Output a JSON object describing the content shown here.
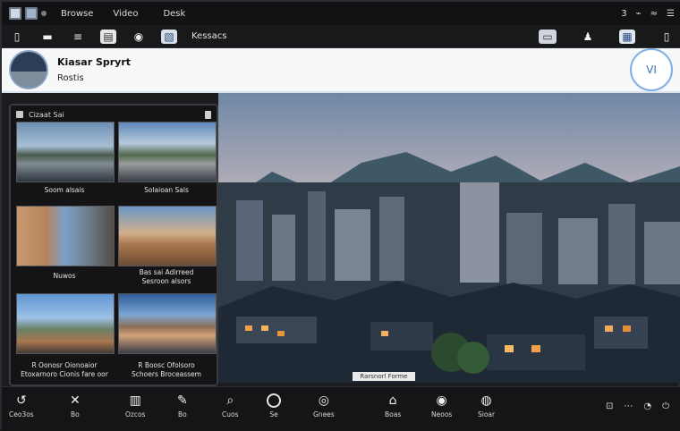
{
  "menubar": {
    "items": [
      "Browse",
      "Video",
      "Desk"
    ],
    "right": [
      "3",
      "⌁",
      "≈",
      "☰"
    ]
  },
  "toolbar": {
    "label": "Kessacs"
  },
  "header": {
    "title": "Kiasar Spryrt",
    "subtitle": "Rostis",
    "badge": "VI"
  },
  "panel": {
    "title": "Cizaat Sai",
    "thumbs": [
      {
        "caption": "Soom alsais"
      },
      {
        "caption": "Solaioan Sals"
      },
      {
        "caption": "Nuwos"
      },
      {
        "caption": "Bas sai Adirreed\nSesroon alsors"
      },
      {
        "caption": "R Oonosr Oionoaior\nEtoxarnoro Cionis fare oor"
      },
      {
        "caption": "R Boosc Ofolsoro\nSchoers Broceassem"
      }
    ]
  },
  "viewer": {
    "chip": "Rarsnorl Forme"
  },
  "taskbar": {
    "items": [
      {
        "label": "Ceo3os"
      },
      {
        "label": "Bo"
      },
      {
        "label": "Ozcos"
      },
      {
        "label": "Bo"
      },
      {
        "label": "Cuos"
      },
      {
        "label": "Se"
      },
      {
        "label": "Gnees"
      },
      {
        "label": "Boas"
      },
      {
        "label": "Neoos"
      },
      {
        "label": "Sioar"
      }
    ],
    "right": [
      "⊡",
      "⋯",
      "◔",
      "⏻"
    ]
  },
  "colors": {
    "header_bg": "#f7f8fa",
    "accent": "#7fb1e6",
    "chrome": "#141517"
  }
}
